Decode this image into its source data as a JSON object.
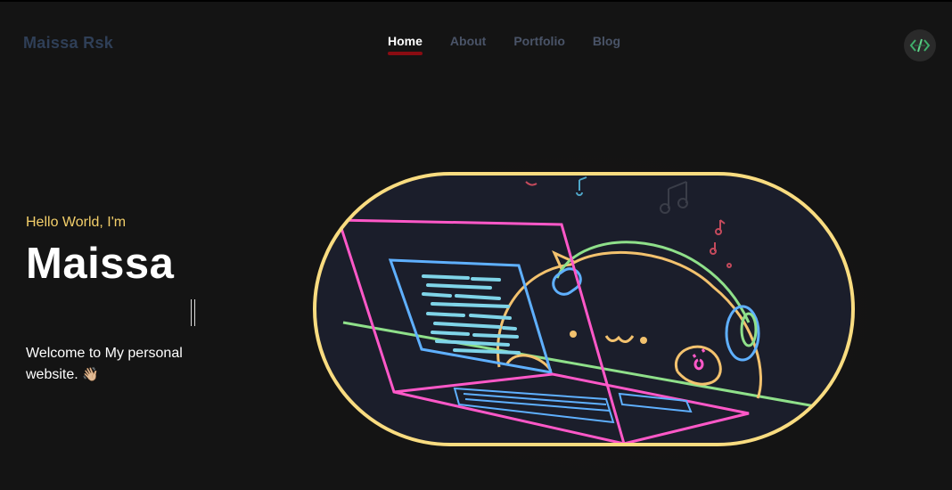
{
  "header": {
    "brand": "Maissa Rsk",
    "nav": [
      {
        "label": "Home",
        "active": true
      },
      {
        "label": "About",
        "active": false
      },
      {
        "label": "Portfolio",
        "active": false
      },
      {
        "label": "Blog",
        "active": false
      }
    ],
    "logo_icon": "code-brackets-icon"
  },
  "hero": {
    "greeting": "Hello World, I'm",
    "name": "Maissa",
    "welcome": "Welcome to My personal website.",
    "wave_emoji": "👋🏼",
    "illustration": "cat-with-headphones-coding-laptop"
  },
  "colors": {
    "accent_yellow": "#f3cf6a",
    "active_underline": "#8a0c12",
    "background": "#141414",
    "brand_text": "#2f3f57",
    "nav_inactive": "#4a5468"
  }
}
